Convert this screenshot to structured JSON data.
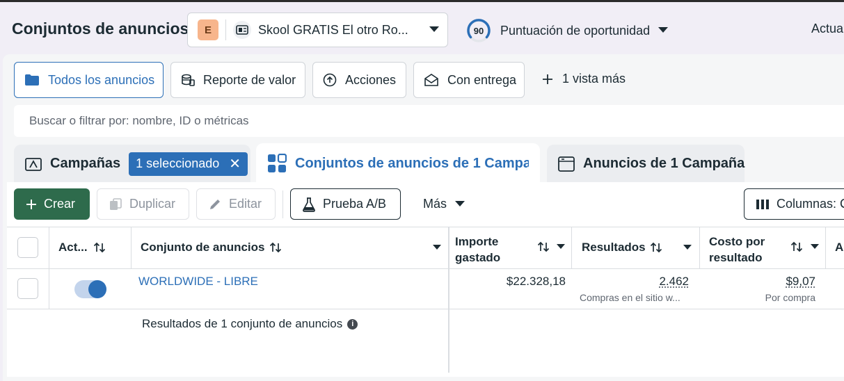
{
  "header": {
    "title": "Conjuntos de anuncios",
    "account_badge": "E",
    "account_name": "Skool GRATIS El otro Ro...",
    "opportunity_score": "90",
    "opportunity_label": "Puntuación de oportunidad",
    "update_label": "Actua"
  },
  "views": {
    "all_ads": "Todos los anuncios",
    "value_report": "Reporte de valor",
    "actions": "Acciones",
    "with_delivery": "Con entrega",
    "more_views": "1 vista más"
  },
  "search": {
    "placeholder": "Buscar o filtrar por: nombre, ID o métricas"
  },
  "tabs": {
    "campaigns": "Campañas",
    "selected_pill": "1 seleccionado",
    "adsets": "Conjuntos de anuncios de 1 Campaña",
    "ads": "Anuncios de 1 Campaña"
  },
  "toolbar": {
    "create": "Crear",
    "duplicate": "Duplicar",
    "edit": "Editar",
    "ab_test": "Prueba A/B",
    "more": "Más",
    "columns": "Columnas: C"
  },
  "table": {
    "headers": {
      "active": "Act...",
      "adset": "Conjunto de anuncios",
      "spend_line1": "Importe",
      "spend_line2": "gastado",
      "results": "Resultados",
      "cpr_line1": "Costo por",
      "cpr_line2": "resultado",
      "next": "A"
    },
    "rows": [
      {
        "name": "WORLDWIDE - LIBRE",
        "active": true,
        "spend": "$22.328,18",
        "results": "2.462",
        "results_sub": "Compras en el sitio w...",
        "cpr": "$9,07",
        "cpr_sub": "Por compra"
      }
    ],
    "summary": "Resultados de 1 conjunto de anuncios"
  },
  "colors": {
    "accent": "#2c6fb7",
    "create_button": "#2e6b4c",
    "badge_e": "#f7b58c"
  }
}
